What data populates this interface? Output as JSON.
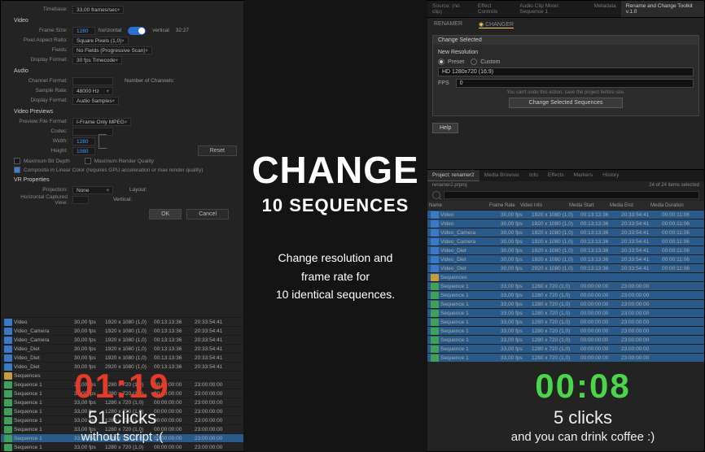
{
  "center": {
    "title": "CHANGE",
    "subtitle": "10 SEQUENCES",
    "line1": "Change resolution and",
    "line2": "frame rate for",
    "line3": "10 identical sequences."
  },
  "leftTimer": {
    "time": "01:19",
    "clicks": "51 clicks",
    "note": "without script :("
  },
  "rightTimer": {
    "time": "00:08",
    "clicks": "5 clicks",
    "note": "and you can drink coffee :)"
  },
  "settings": {
    "timebase_label": "Timebase:",
    "timebase": "33,00 frames/sec",
    "video_hdr": "Video",
    "framesize_label": "Frame Size:",
    "framesize_w": "1280",
    "framesize_h": "horizontal",
    "framesize_v": "vertical",
    "framesize_aspect": "32:27",
    "par_label": "Pixel Aspect Ratio:",
    "par": "Square Pixels (1,0)",
    "fields_label": "Fields:",
    "fields": "No Fields (Progressive Scan)",
    "dispfmt_label": "Display Format:",
    "dispfmt": "30 fps Timecode",
    "audio_hdr": "Audio",
    "chfmt_label": "Channel Format:",
    "chfmt": "",
    "chnum_label": "Number of Channels:",
    "srate_label": "Sample Rate:",
    "srate": "48000 Hz",
    "adispfmt_label": "Display Format:",
    "adispfmt": "Audio Samples",
    "preview_hdr": "Video Previews",
    "pff_label": "Preview File Format:",
    "pff": "I-Frame Only MPEG",
    "codec_label": "Codec:",
    "codec": "",
    "width_label": "Width:",
    "width": "1280",
    "height_label": "Height:",
    "height": "1080",
    "reset": "Reset",
    "maxdepth": "Maximum Bit Depth",
    "maxrq": "Maximum Render Quality",
    "linear": "Composite in Linear Color (requires GPU acceleration or max render quality)",
    "vrprops": "VR Properties",
    "proj_label": "Projection:",
    "proj": "None",
    "layout_label": "Layout:",
    "hcv_label": "Horizontal Captured View:",
    "vcv_label": "Vertical:",
    "ok": "OK",
    "cancel": "Cancel"
  },
  "leftBins": {
    "rows": [
      {
        "t": "mov",
        "n": "Video",
        "f": "30,00 fps",
        "a": "1920 x 1080 (1,0)",
        "b": "00:13:13:36",
        "d": "20:33:54:41"
      },
      {
        "t": "mov",
        "n": "Video_Camera",
        "f": "30,00 fps",
        "a": "1920 x 1080 (1,0)",
        "b": "00:13:13:36",
        "d": "20:33:54:41"
      },
      {
        "t": "mov",
        "n": "Video_Camera",
        "f": "30,00 fps",
        "a": "1920 x 1080 (1,0)",
        "b": "00:13:13:36",
        "d": "20:33:54:41"
      },
      {
        "t": "mov",
        "n": "Video_Diet",
        "f": "30,00 fps",
        "a": "1920 x 1080 (1,0)",
        "b": "00:13:13:36",
        "d": "20:33:54:41"
      },
      {
        "t": "mov",
        "n": "Video_Diet",
        "f": "30,00 fps",
        "a": "1920 x 1080 (1,0)",
        "b": "00:13:13:36",
        "d": "20:33:54:41"
      },
      {
        "t": "mov",
        "n": "Video_Diet",
        "f": "30,00 fps",
        "a": "2920 x 1080 (1,0)",
        "b": "00:13:13:36",
        "d": "20:33:54:41"
      },
      {
        "t": "fld",
        "n": "Sequences",
        "f": "",
        "a": "",
        "b": "",
        "d": ""
      },
      {
        "t": "seq",
        "n": "Sequence 1",
        "f": "33,00 fps",
        "a": "1280 x 720 (1,0)",
        "b": "00:00:00:00",
        "d": "23:00:00:00"
      },
      {
        "t": "seq",
        "n": "Sequence 1",
        "f": "33,00 fps",
        "a": "1280 x 720 (1,0)",
        "b": "00:00:00:00",
        "d": "23:00:00:00"
      },
      {
        "t": "seq",
        "n": "Sequence 1",
        "f": "33,00 fps",
        "a": "1280 x 720 (1,0)",
        "b": "00:00:00:00",
        "d": "23:00:00:00"
      },
      {
        "t": "seq",
        "n": "Sequence 1",
        "f": "33,00 fps",
        "a": "1280 x 720 (1,0)",
        "b": "00:00:00:00",
        "d": "23:00:00:00"
      },
      {
        "t": "seq",
        "n": "Sequence 1",
        "f": "33,00 fps",
        "a": "1280 x 720 (1,0)",
        "b": "00:00:00:00",
        "d": "23:00:00:00"
      },
      {
        "t": "seq",
        "n": "Sequence 1",
        "f": "33,00 fps",
        "a": "1280 x 720 (1,0)",
        "b": "00:00:00:00",
        "d": "23:00:00:00"
      },
      {
        "t": "seq",
        "n": "Sequence 1",
        "f": "33,00 fps",
        "a": "2920 x 720 (1,0)",
        "b": "00:00:00:00",
        "d": "23:00:00:00"
      },
      {
        "t": "seq",
        "n": "Sequence 1",
        "f": "33,00 fps",
        "a": "1280 x 720 (1,0)",
        "b": "00:00:00:00",
        "d": "23:00:00:00"
      }
    ],
    "sel": 13
  },
  "changer": {
    "topTabs": [
      "Source: (no clip)",
      "Effect Controls",
      "Audio Clip Mixer: Sequence 1",
      "Metadata",
      "Rename and Change Toolkit v.1.0"
    ],
    "sub": [
      "RENAMER",
      "CHANGER"
    ],
    "box_title": "Change Selected",
    "new_res": "New Resolution",
    "preset": "Preset",
    "custom": "Custom",
    "res_value": "HD 1280x720 (16:9)",
    "fps_label": "FPS",
    "fps_value": "0",
    "hint": "You can't undo this action, save the project before use.",
    "change_btn": "Change Selected Sequences",
    "help": "Help"
  },
  "proj": {
    "tabs": [
      "Project: renamer2",
      "Media Browser",
      "Info",
      "Effects",
      "Markers",
      "History"
    ],
    "info_left": "renamer2.prproj",
    "info_right": "24 of 24 items selected",
    "head": [
      "Name",
      "Frame Rate",
      "Video Info",
      "Media Start",
      "Media End",
      "Media Duration"
    ],
    "rows": [
      {
        "t": "mov",
        "n": "Video",
        "f": "30,00 fps",
        "a": "1920 x 1080 (1,0)",
        "b": "00:13:13:36",
        "d": "20:33:54:41",
        "e": "00:00:11:06"
      },
      {
        "t": "mov",
        "n": "Video",
        "f": "30,00 fps",
        "a": "1920 x 1080 (1,0)",
        "b": "00:13:13:36",
        "d": "20:33:54:41",
        "e": "00:00:11:06"
      },
      {
        "t": "mov",
        "n": "Video_Camera",
        "f": "30,00 fps",
        "a": "1920 x 1080 (1,0)",
        "b": "00:13:13:36",
        "d": "20:33:54:41",
        "e": "00:00:11:06"
      },
      {
        "t": "mov",
        "n": "Video_Camera",
        "f": "30,00 fps",
        "a": "1920 x 1080 (1,0)",
        "b": "00:13:13:36",
        "d": "20:33:54:41",
        "e": "00:00:11:06"
      },
      {
        "t": "mov",
        "n": "Video_Diet",
        "f": "30,00 fps",
        "a": "1920 x 1080 (1,0)",
        "b": "00:13:13:36",
        "d": "20:33:54:41",
        "e": "00:00:11:06"
      },
      {
        "t": "mov",
        "n": "Video_Diet",
        "f": "30,00 fps",
        "a": "1920 x 1080 (1,0)",
        "b": "00:13:13:36",
        "d": "20:33:54:41",
        "e": "00:00:11:06"
      },
      {
        "t": "mov",
        "n": "Video_Diet",
        "f": "30,00 fps",
        "a": "2920 x 1080 (1,0)",
        "b": "00:13:13:36",
        "d": "20:33:54:41",
        "e": "00:00:11:06"
      },
      {
        "t": "fld",
        "n": "Sequences",
        "f": "",
        "a": "",
        "b": "",
        "d": "",
        "e": ""
      },
      {
        "t": "seq",
        "n": "Sequence 1",
        "f": "33,00 fps",
        "a": "1280 x 720 (1,0)",
        "b": "00:00:00:00",
        "d": "23:00:00:00",
        "e": ""
      },
      {
        "t": "seq",
        "n": "Sequence 1",
        "f": "33,00 fps",
        "a": "1280 x 720 (1,0)",
        "b": "00:00:00:00",
        "d": "23:00:00:00",
        "e": ""
      },
      {
        "t": "seq",
        "n": "Sequence 1",
        "f": "33,00 fps",
        "a": "1280 x 720 (1,0)",
        "b": "00:00:00:00",
        "d": "23:00:00:00",
        "e": ""
      },
      {
        "t": "seq",
        "n": "Sequence 1",
        "f": "33,00 fps",
        "a": "1280 x 720 (1,0)",
        "b": "00:00:00:00",
        "d": "23:00:00:00",
        "e": ""
      },
      {
        "t": "seq",
        "n": "Sequence 1",
        "f": "33,00 fps",
        "a": "1280 x 720 (1,0)",
        "b": "00:00:00:00",
        "d": "23:00:00:00",
        "e": ""
      },
      {
        "t": "seq",
        "n": "Sequence 1",
        "f": "33,00 fps",
        "a": "1280 x 720 (1,0)",
        "b": "00:00:00:00",
        "d": "23:00:00:00",
        "e": ""
      },
      {
        "t": "seq",
        "n": "Sequence 1",
        "f": "33,00 fps",
        "a": "1280 x 720 (1,0)",
        "b": "00:00:00:00",
        "d": "23:00:00:00",
        "e": ""
      },
      {
        "t": "seq",
        "n": "Sequence 1",
        "f": "33,00 fps",
        "a": "1280 x 720 (1,0)",
        "b": "00:00:00:00",
        "d": "23:00:00:00",
        "e": ""
      },
      {
        "t": "seq",
        "n": "Sequence 1",
        "f": "33,00 fps",
        "a": "1280 x 720 (1,0)",
        "b": "00:00:00:00",
        "d": "23:00:00:00",
        "e": ""
      }
    ]
  }
}
